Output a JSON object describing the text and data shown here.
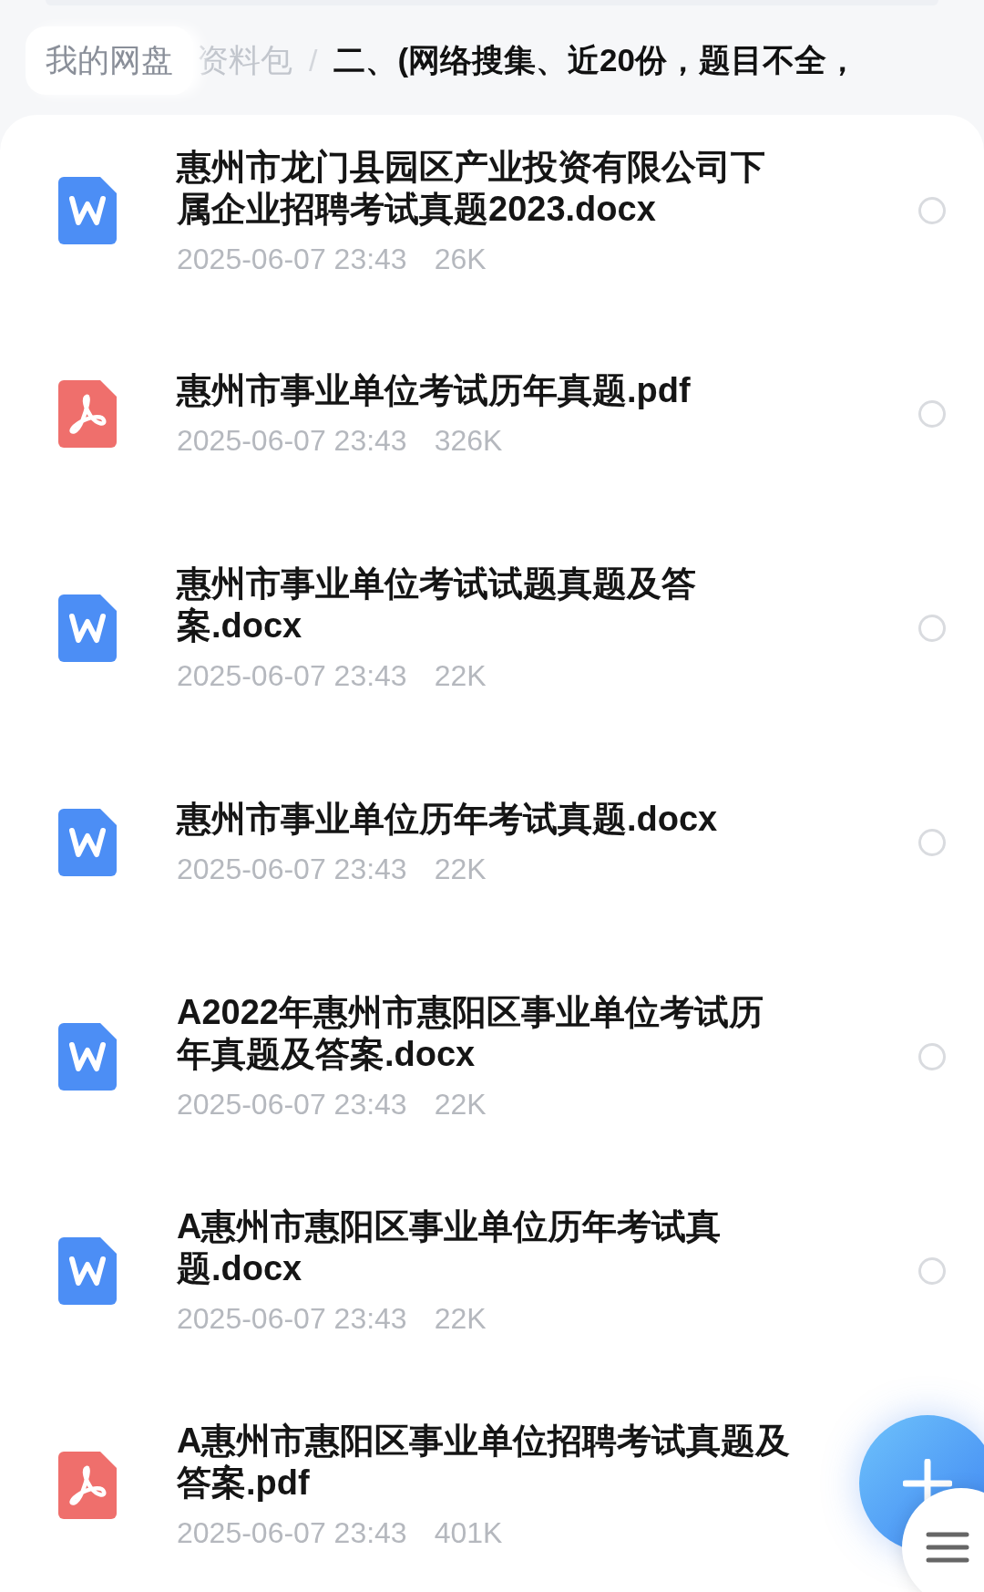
{
  "breadcrumb": {
    "root": "我的网盘",
    "parent": "资料包",
    "separator": "/",
    "current": "二、(网络搜集、近20份，题目不全，"
  },
  "files": [
    {
      "kind": "word",
      "name": "惠州市龙门县园区产业投资有限公司下属企业招聘考试真题2023.docx",
      "date": "2025-06-07 23:43",
      "size": "26K",
      "selected": false
    },
    {
      "kind": "pdf",
      "name": "惠州市事业单位考试历年真题.pdf",
      "date": "2025-06-07 23:43",
      "size": "326K",
      "selected": false
    },
    {
      "kind": "word",
      "name": "惠州市事业单位考试试题真题及答案.docx",
      "date": "2025-06-07 23:43",
      "size": "22K",
      "selected": false
    },
    {
      "kind": "word",
      "name": "惠州市事业单位历年考试真题.docx",
      "date": "2025-06-07 23:43",
      "size": "22K",
      "selected": false
    },
    {
      "kind": "word",
      "name": "A2022年惠州市惠阳区事业单位考试历年真题及答案.docx",
      "date": "2025-06-07 23:43",
      "size": "22K",
      "selected": false
    },
    {
      "kind": "word",
      "name": "A惠州市惠阳区事业单位历年考试真题.docx",
      "date": "2025-06-07 23:43",
      "size": "22K",
      "selected": false
    },
    {
      "kind": "pdf",
      "name": "A惠州市惠阳区事业单位招聘考试真题及答案.pdf",
      "date": "2025-06-07 23:43",
      "size": "401K"
    }
  ]
}
